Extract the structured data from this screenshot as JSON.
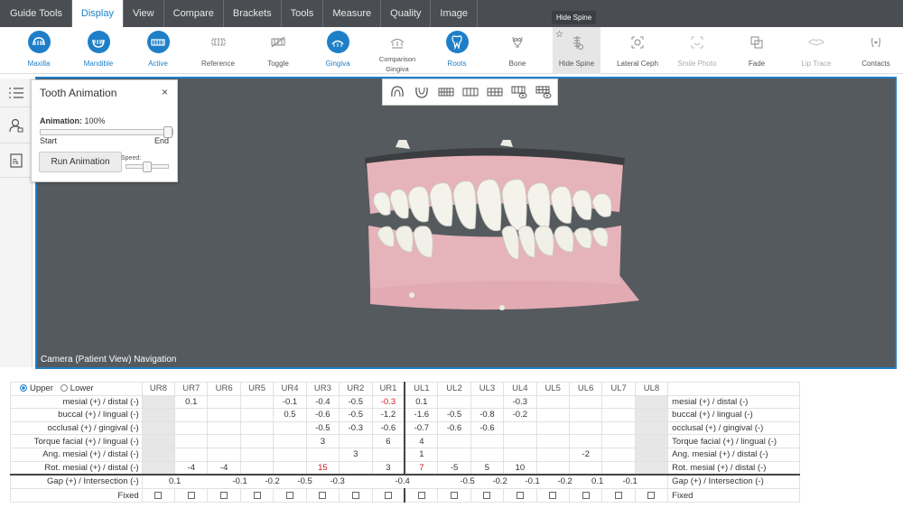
{
  "menu": [
    {
      "label": "Guide Tools",
      "active": false
    },
    {
      "label": "Display",
      "active": true
    },
    {
      "label": "View",
      "active": false
    },
    {
      "label": "Compare",
      "active": false
    },
    {
      "label": "Brackets",
      "active": false
    },
    {
      "label": "Tools",
      "active": false
    },
    {
      "label": "Measure",
      "active": false
    },
    {
      "label": "Quality",
      "active": false
    },
    {
      "label": "Image",
      "active": false
    }
  ],
  "ribbon": {
    "maxilla": "Maxilla",
    "mandible": "Mandible",
    "active": "Active",
    "reference": "Reference",
    "toggle": "Toggle",
    "gingiva": "Gingiva",
    "comparison_gingiva_1": "Comparison",
    "comparison_gingiva_2": "Gingiva",
    "roots": "Roots",
    "bone": "Bone",
    "hide_spine": "Hide Spine",
    "lateral_ceph": "Lateral Ceph",
    "smile_photo": "Smile Photo",
    "fade": "Fade",
    "lip_trace": "Lip Trace",
    "contacts": "Contacts"
  },
  "tooltip": "Hide Spine",
  "viewport": {
    "caption": "Camera (Patient View) Navigation"
  },
  "anim": {
    "title": "Tooth Animation",
    "close": "×",
    "label": "Animation:",
    "value_text": "100%",
    "value": 1.0,
    "start": "Start",
    "end": "End",
    "run": "Run Animation",
    "speed": "Speed:",
    "speed_value": 0.5
  },
  "table": {
    "upper": "Upper",
    "lower": "Lower",
    "teeth": [
      "UR8",
      "UR7",
      "UR6",
      "UR5",
      "UR4",
      "UR3",
      "UR2",
      "UR1",
      "UL1",
      "UL2",
      "UL3",
      "UL4",
      "UL5",
      "UL6",
      "UL7",
      "UL8"
    ],
    "rows": [
      {
        "left": "mesial (+) / distal (-)",
        "right": "mesial (+) / distal (-)",
        "cells": [
          "",
          "0.1",
          "",
          "",
          "-0.1",
          "-0.4",
          "-0.5",
          "-0.3",
          "0.1",
          "",
          "",
          "-0.3",
          "",
          "",
          "",
          ""
        ],
        "red": [
          7
        ]
      },
      {
        "left": "buccal (+) / lingual (-)",
        "right": "buccal (+) / lingual (-)",
        "cells": [
          "",
          "",
          "",
          "",
          "0.5",
          "-0.6",
          "-0.5",
          "-1.2",
          "-1.6",
          "-0.5",
          "-0.8",
          "-0.2",
          "",
          "",
          "",
          ""
        ],
        "red": []
      },
      {
        "left": "occlusal (+) / gingival (-)",
        "right": "occlusal (+) / gingival (-)",
        "cells": [
          "",
          "",
          "",
          "",
          "",
          "-0.5",
          "-0.3",
          "-0.6",
          "-0.7",
          "-0.6",
          "-0.6",
          "",
          "",
          "",
          "",
          ""
        ],
        "red": []
      },
      {
        "left": "Torque facial (+) / lingual (-)",
        "right": "Torque facial (+) / lingual (-)",
        "cells": [
          "",
          "",
          "",
          "",
          "",
          "3",
          "",
          "6",
          "4",
          "",
          "",
          "",
          "",
          "",
          "",
          ""
        ],
        "red": []
      },
      {
        "left": "Ang. mesial (+) / distal (-)",
        "right": "Ang. mesial (+) / distal (-)",
        "cells": [
          "",
          "",
          "",
          "",
          "",
          "",
          "3",
          "",
          "1",
          "",
          "",
          "",
          "",
          "-2",
          "",
          ""
        ],
        "red": []
      },
      {
        "left": "Rot. mesial (+) / distal (-)",
        "right": "Rot. mesial (+) / distal (-)",
        "cells": [
          "",
          "-4",
          "-4",
          "",
          "",
          "15",
          "",
          "3",
          "7",
          "-5",
          "5",
          "10",
          "",
          "",
          "",
          ""
        ],
        "red": [
          5,
          8
        ]
      }
    ],
    "gap": {
      "left": "Gap (+) / Intersection (-)",
      "right": "Gap (+) / Intersection (-)",
      "values": [
        "0.1",
        "",
        "-0.1",
        "-0.2",
        "-0.5",
        "-0.3",
        "",
        "-0.4",
        "",
        "-0.5",
        "-0.2",
        "-0.1",
        "-0.2",
        "0.1",
        "-0.1"
      ]
    },
    "fixed": {
      "left": "Fixed",
      "right": "Fixed"
    }
  },
  "colors": {
    "accent": "#1e7fc8",
    "menubar": "#4a4d52",
    "viewport": "#555a5e",
    "gum": "#e8b4bc",
    "teeth": "#f1f1ea",
    "red": "#d0191f"
  }
}
